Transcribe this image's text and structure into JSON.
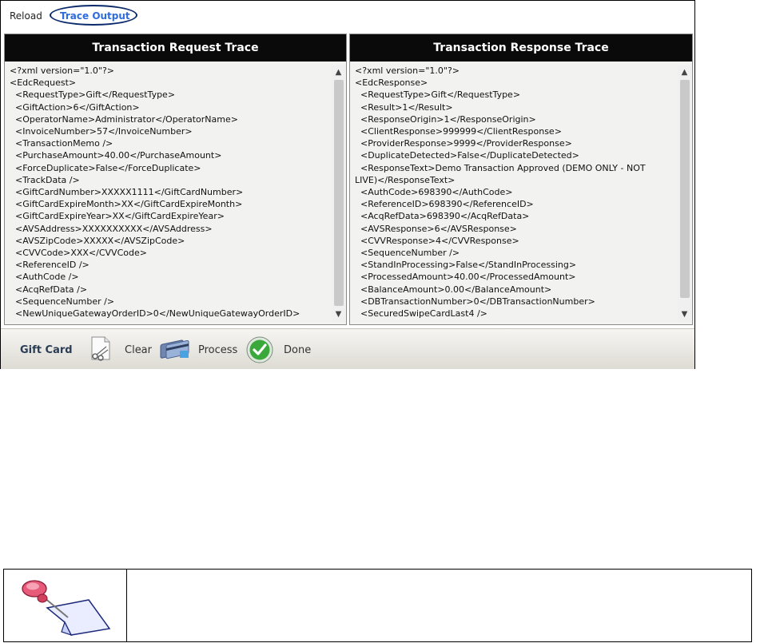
{
  "toolbar": {
    "reload": "Reload",
    "trace_output": "Trace Output"
  },
  "request_pane": {
    "title": "Transaction Request Trace",
    "lines": [
      "<?xml version=\"1.0\"?>",
      "<EdcRequest>",
      "  <RequestType>Gift</RequestType>",
      "  <GiftAction>6</GiftAction>",
      "  <OperatorName>Administrator</OperatorName>",
      "  <InvoiceNumber>57</InvoiceNumber>",
      "  <TransactionMemo />",
      "  <PurchaseAmount>40.00</PurchaseAmount>",
      "  <ForceDuplicate>False</ForceDuplicate>",
      "  <TrackData />",
      "  <GiftCardNumber>XXXXX1111</GiftCardNumber>",
      "  <GiftCardExpireMonth>XX</GiftCardExpireMonth>",
      "  <GiftCardExpireYear>XX</GiftCardExpireYear>",
      "  <AVSAddress>XXXXXXXXXX</AVSAddress>",
      "  <AVSZipCode>XXXXX</AVSZipCode>",
      "  <CVVCode>XXX</CVVCode>",
      "  <ReferenceID />",
      "  <AuthCode />",
      "  <AcqRefData />",
      "  <SequenceNumber />",
      "  <NewUniqueGatewayOrderID>0</NewUniqueGatewayOrderID>"
    ]
  },
  "response_pane": {
    "title": "Transaction Response Trace",
    "lines": [
      "<?xml version=\"1.0\"?>",
      "<EdcResponse>",
      "  <RequestType>Gift</RequestType>",
      "  <Result>1</Result>",
      "  <ResponseOrigin>1</ResponseOrigin>",
      "  <ClientResponse>999999</ClientResponse>",
      "  <ProviderResponse>9999</ProviderResponse>",
      "  <DuplicateDetected>False</DuplicateDetected>",
      "  <ResponseText>Demo Transaction Approved (DEMO ONLY - NOT",
      "LIVE)</ResponseText>",
      "  <AuthCode>698390</AuthCode>",
      "  <ReferenceID>698390</ReferenceID>",
      "  <AcqRefData>698390</AcqRefData>",
      "  <AVSResponse>6</AVSResponse>",
      "  <CVVResponse>4</CVVResponse>",
      "  <SequenceNumber />",
      "  <StandInProcessing>False</StandInProcessing>",
      "  <ProcessedAmount>40.00</ProcessedAmount>",
      "  <BalanceAmount>0.00</BalanceAmount>",
      "  <DBTransactionNumber>0</DBTransactionNumber>",
      "  <SecuredSwipeCardLast4 />"
    ]
  },
  "footer": {
    "gift_card": "Gift Card",
    "clear": "Clear",
    "process": "Process",
    "done": "Done"
  },
  "colors": {
    "header_bg": "#0a0a0a",
    "tab_link": "#2d6cdf",
    "done_green": "#3aa83a"
  },
  "icons": {
    "clear": "scissors-paper-icon",
    "process": "credit-card-icon",
    "done": "check-circle-icon",
    "note": "push-pin-note-icon"
  }
}
